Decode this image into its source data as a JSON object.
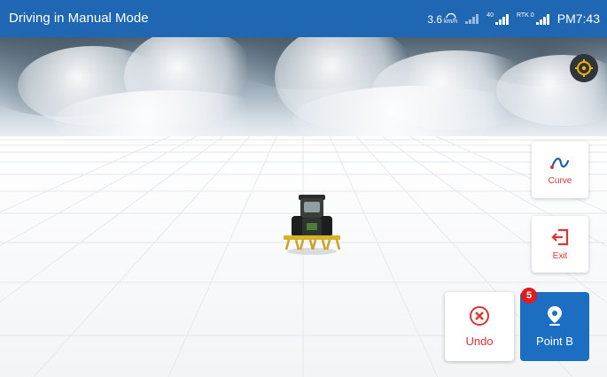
{
  "status_bar": {
    "title": "Driving in Manual Mode",
    "speed_value": "3.6",
    "speed_unit": "km/h",
    "gnss_count": "40",
    "rtk_label": "RTK",
    "rtk_sub": "0",
    "time": "PM7:43"
  },
  "buttons": {
    "curve_label": "Curve",
    "exit_label": "Exit",
    "undo_label": "Undo",
    "point_b_label": "Point B",
    "point_b_badge": "5"
  },
  "colors": {
    "status_bar": "#1f66b3",
    "primary": "#1b6ec2",
    "accent_red": "#d33333",
    "badge": "#e11c1c",
    "target_icon": "#f2b300"
  },
  "icons": {
    "speed": "speedometer-icon",
    "signal": "signal-bars-icon",
    "gnss": "satellite-signal-icon",
    "rtk": "rtk-signal-icon",
    "locate": "crosshair-target-icon",
    "curve": "curve-line-icon",
    "exit": "exit-icon",
    "undo": "close-circle-icon",
    "point_b": "map-pin-icon",
    "vehicle": "tractor-icon"
  }
}
